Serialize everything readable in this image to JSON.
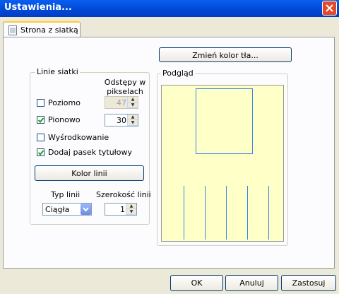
{
  "window": {
    "title": "Ustawienia..."
  },
  "tabs": [
    {
      "label": "Strona z siatką"
    }
  ],
  "change_bg_button": "Zmień kolor tła...",
  "grid_group": {
    "legend": "Linie siatki",
    "spacing_header": "Odstępy w pikselach",
    "horizontal": {
      "label": "Poziomo",
      "checked": false,
      "value": "47"
    },
    "vertical": {
      "label": "Pionowo",
      "checked": true,
      "value": "30"
    },
    "center": {
      "label": "Wyśrodkowanie",
      "checked": false
    },
    "title_bar": {
      "label": "Dodaj pasek tytułowy",
      "checked": true
    },
    "line_color_button": "Kolor linii",
    "line_type_label": "Typ linii",
    "line_type_value": "Ciągła",
    "line_width_label": "Szerokość linii",
    "line_width_value": "1"
  },
  "preview_group": {
    "legend": "Podgląd"
  },
  "buttons": {
    "ok": "OK",
    "cancel": "Anuluj",
    "apply": "Zastosuj"
  },
  "colors": {
    "titlebar": "#0054e3",
    "preview_bg": "#ffffc8",
    "grid_line": "#3c82e6"
  }
}
